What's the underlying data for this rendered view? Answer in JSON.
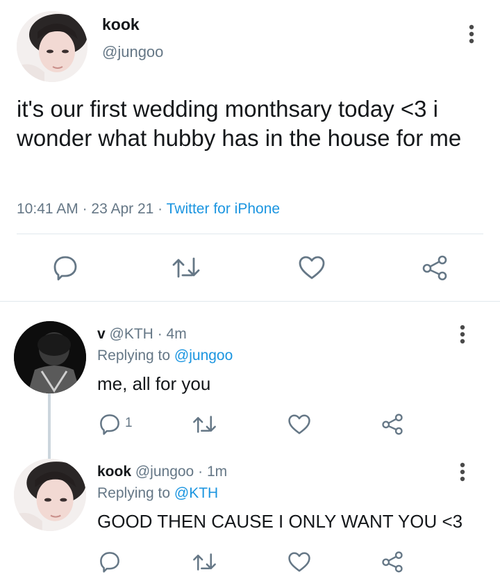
{
  "main_tweet": {
    "display_name": "kook",
    "handle": "@jungoo",
    "text": "it's our first wedding monthsary today <3 i wonder what hubby has in the house for me",
    "time": "10:41 AM",
    "sep1": "·",
    "date": "23 Apr 21",
    "sep2": "·",
    "source": "Twitter for iPhone",
    "avatar_icon": "user-photo",
    "more_icon": "more-vertical-icon"
  },
  "replies": [
    {
      "display_name": "v",
      "handle": "@KTH",
      "sep": "·",
      "age": "4m",
      "replying_prefix": "Replying to",
      "replying_to": "@jungoo",
      "text": "me, all for you",
      "reply_count": "1"
    },
    {
      "display_name": "kook",
      "handle": "@jungoo",
      "sep": "·",
      "age": "1m",
      "replying_prefix": "Replying to",
      "replying_to": "@KTH",
      "text": "GOOD THEN CAUSE I ONLY WANT YOU <3",
      "reply_count": ""
    }
  ],
  "colors": {
    "link_blue": "#1b95e0",
    "gray_text": "#657786",
    "icon_gray": "#657786",
    "divider": "#e1e8ed"
  }
}
